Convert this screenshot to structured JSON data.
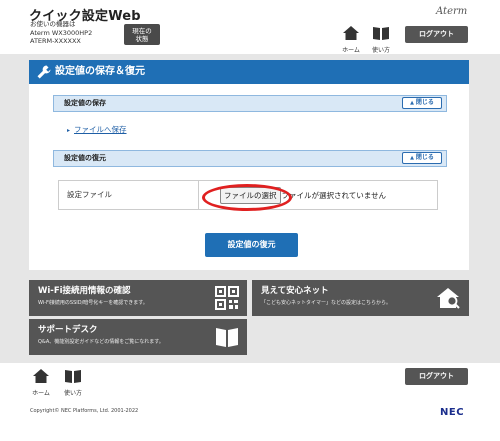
{
  "header": {
    "app_title": "クイック設定Web",
    "device_info_line1": "お使いの機器は",
    "device_info_line2": "Aterm WX3000HP2",
    "device_info_line3": "ATERM-XXXXXX",
    "status_button_line1": "現在の",
    "status_button_line2": "状態",
    "brand": "Aterm",
    "home_label": "ホーム",
    "manual_label": "使い方",
    "logout_label": "ログアウト"
  },
  "main": {
    "section_title": "設定値の保存＆復元",
    "save_section": {
      "title": "設定値の保存",
      "close_label": "閉じる",
      "link_label": "ファイルへ保存"
    },
    "restore_section": {
      "title": "設定値の復元",
      "close_label": "閉じる",
      "file_label": "設定ファイル",
      "choose_file_button": "ファイルの選択",
      "no_file_text": "ファイルが選択されていません",
      "restore_button": "設定値の復元"
    }
  },
  "cards": {
    "wifi": {
      "title": "Wi-Fi接続用情報の確認",
      "desc": "Wi-Fi接続用のSSID/暗号化キーを確認できます。",
      "icon": "qr-code-icon"
    },
    "safe_net": {
      "title": "見えて安心ネット",
      "desc": "「こども安心ネットタイマー」などの設定はこちらから。",
      "icon": "home-search-icon"
    },
    "support": {
      "title": "サポートデスク",
      "desc": "Q&A、機能別設定ガイドなどの情報をご覧になれます。",
      "icon": "book-icon"
    }
  },
  "footer": {
    "home_label": "ホーム",
    "manual_label": "使い方",
    "logout_label": "ログアウト",
    "copyright": "Copyright© NEC Platforms, Ltd. 2001-2022",
    "nec_logo": "NEC"
  },
  "colors": {
    "primary_blue": "#1f6fb5",
    "sub_header_bg": "#d9e8f6",
    "dark_button": "#555555",
    "highlight_red": "#e02020"
  }
}
